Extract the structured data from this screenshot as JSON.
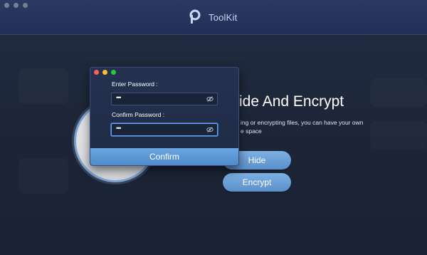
{
  "app": {
    "name": "ToolKit"
  },
  "main": {
    "title": "ide And Encrypt",
    "description": "ing or encrypting files, you can have your own\ne space",
    "buttons": {
      "hide": "Hide",
      "encrypt": "Encrypt"
    }
  },
  "dialog": {
    "enter_label": "Enter Password :",
    "enter_value": "•••",
    "confirm_label": "Confirm Password :",
    "confirm_value": "•••",
    "confirm_button": "Confirm"
  },
  "colors": {
    "titlebar": "#223058",
    "accent": "#5b8fcb",
    "background": "#1c2536"
  },
  "icons": {
    "logo": "toolkit-logo",
    "eye": "eye-off-icon"
  }
}
